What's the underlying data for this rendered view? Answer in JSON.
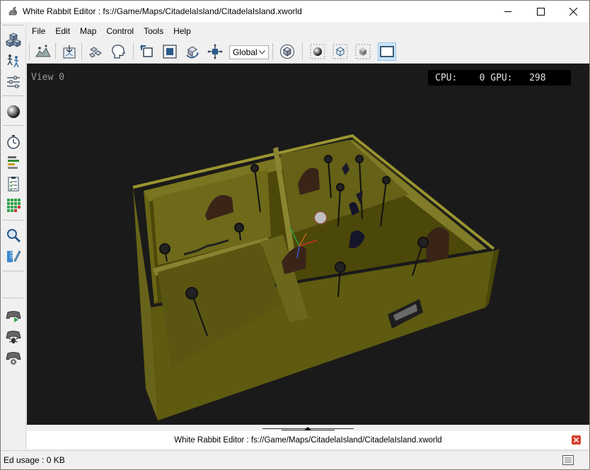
{
  "window": {
    "title": "White Rabbit Editor : fs://Game/Maps/CitadelaIsland/CitadelaIsland.xworld"
  },
  "menu": {
    "items": [
      "File",
      "Edit",
      "Map",
      "Control",
      "Tools",
      "Help"
    ]
  },
  "toolbar": {
    "coord_space": "Global"
  },
  "viewport": {
    "view_label": "View 0",
    "cpu_label": "CPU:",
    "cpu_value": "0",
    "gpu_label": "GPU:",
    "gpu_value": "298"
  },
  "bottom_panel": {
    "title": "White Rabbit Editor : fs://Game/Maps/CitadelaIsland/CitadelaIsland.xworld"
  },
  "status": {
    "ed_usage": "Ed usage : 0 KB"
  },
  "colors": {
    "viewport_bg": "#1a1a1a",
    "wall_olive": "#6e6a16",
    "floor_olive": "#4e4a0c",
    "accent_blue": "#0078d7"
  }
}
